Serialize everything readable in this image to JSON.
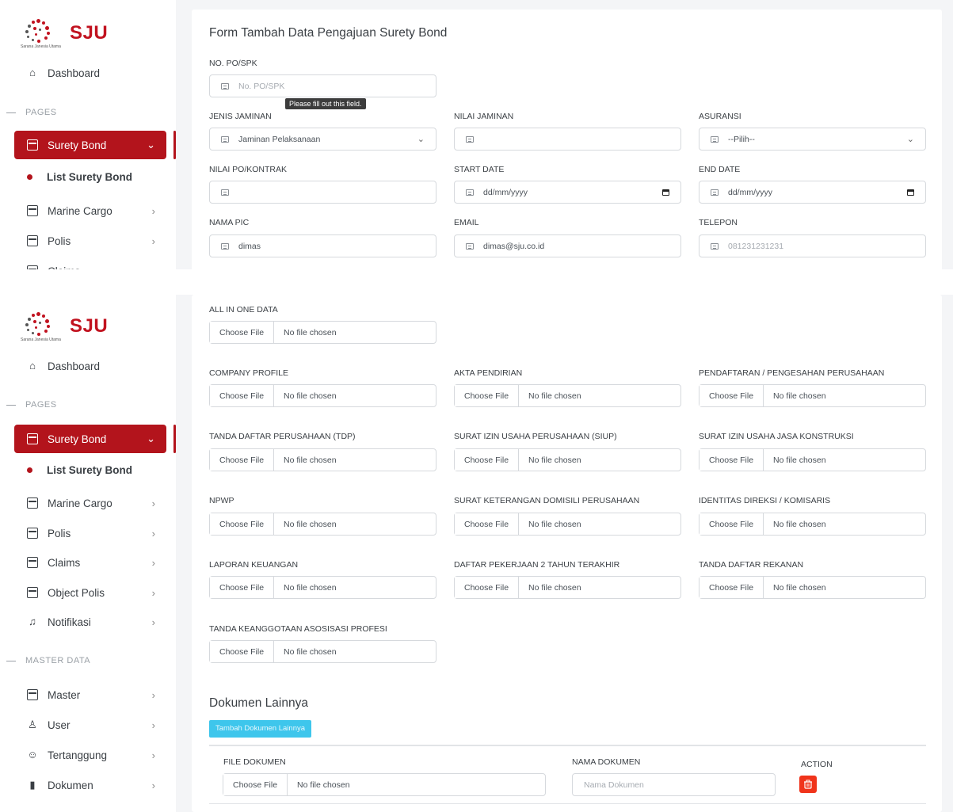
{
  "brand": {
    "name": "SJU",
    "tagline": "Sarana Janesia Utama",
    "accent": "#b3141c"
  },
  "sidebar": {
    "dashboard": "Dashboard",
    "pages_label": "PAGES",
    "master_label": "MASTER DATA",
    "items": {
      "surety_bond": "Surety Bond",
      "list_surety_bond": "List Surety Bond",
      "marine_cargo": "Marine Cargo",
      "polis": "Polis",
      "claims": "Claims",
      "object_polis": "Object Polis",
      "notifikasi": "Notifikasi",
      "master": "Master",
      "user": "User",
      "tertanggung": "Tertanggung",
      "dokumen": "Dokumen"
    }
  },
  "form": {
    "title": "Form Tambah Data Pengajuan Surety Bond",
    "tooltip": "Please fill out this field.",
    "fields": {
      "no_po": {
        "label": "NO. PO/SPK",
        "placeholder": "No. PO/SPK",
        "value": ""
      },
      "jenis_jaminan": {
        "label": "JENIS JAMINAN",
        "value": "Jaminan Pelaksanaan"
      },
      "nilai_jaminan": {
        "label": "NILAI JAMINAN",
        "value": ""
      },
      "asuransi": {
        "label": "ASURANSI",
        "value": "--Pilih--"
      },
      "nilai_po": {
        "label": "NILAI PO/KONTRAK",
        "value": ""
      },
      "start_date": {
        "label": "START DATE",
        "value": "dd/mm/yyyy"
      },
      "end_date": {
        "label": "END DATE",
        "value": "dd/mm/yyyy"
      },
      "nama_pic": {
        "label": "NAMA PIC",
        "value": "dimas"
      },
      "email": {
        "label": "EMAIL",
        "value": "dimas@sju.co.id"
      },
      "telepon": {
        "label": "TELEPON",
        "placeholder": "081231231231",
        "value": ""
      }
    }
  },
  "uploads": {
    "choose_label": "Choose File",
    "no_file": "No file chosen",
    "all_in_one": "ALL IN ONE DATA",
    "company_profile": "COMPANY PROFILE",
    "akta_pendirian": "AKTA PENDIRIAN",
    "pendaftaran": "PENDAFTARAN / PENGESAHAN PERUSAHAAN",
    "tdp": "TANDA DAFTAR PERUSAHAAN (TDP)",
    "siup": "SURAT IZIN USAHA PERUSAHAAN (SIUP)",
    "siujk": "SURAT IZIN USAHA JASA KONSTRUKSI",
    "npwp": "NPWP",
    "domisili": "SURAT KETERANGAN DOMISILI PERUSAHAAN",
    "identitas": "IDENTITAS DIREKSI / KOMISARIS",
    "laporan": "LAPORAN KEUANGAN",
    "daftar_pekerjaan": "DAFTAR PEKERJAAN 2 TAHUN TERAKHIR",
    "rekanan": "TANDA DAFTAR REKANAN",
    "asosiasi": "TANDA KEANGGOTAAN ASOSISASI PROFESI"
  },
  "other_docs": {
    "title": "Dokumen Lainnya",
    "add_button": "Tambah Dokumen Lainnya",
    "col_file": "FILE DOKUMEN",
    "col_name": "NAMA DOKUMEN",
    "col_action": "ACTION",
    "name_placeholder": "Nama Dokumen"
  }
}
